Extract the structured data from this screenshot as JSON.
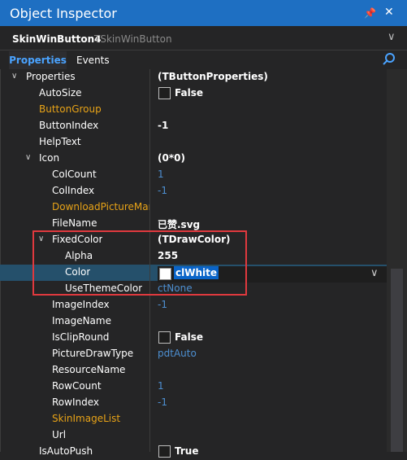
{
  "window": {
    "title": "Object Inspector",
    "pin_icon": "pin-icon",
    "close_icon": "close-icon"
  },
  "object_selector": {
    "name": "SkinWinButton4",
    "type": "TSkinWinButton"
  },
  "tabs": [
    {
      "label": "Properties",
      "active": true
    },
    {
      "label": "Events",
      "active": false
    }
  ],
  "colors": {
    "accent": "#1e6fc2",
    "selected_row": "#25506b",
    "highlight_box": "#e0393e",
    "orange_name": "#e8a317",
    "blue_value": "#4d8fd1"
  },
  "rows": [
    {
      "name": "Properties",
      "value": "(TButtonProperties)"
    },
    {
      "name": "AutoSize",
      "value": "False"
    },
    {
      "name": "ButtonGroup",
      "value": ""
    },
    {
      "name": "ButtonIndex",
      "value": "-1"
    },
    {
      "name": "HelpText",
      "value": ""
    },
    {
      "name": "Icon",
      "value": "(0*0)"
    },
    {
      "name": "ColCount",
      "value": "1"
    },
    {
      "name": "ColIndex",
      "value": "-1"
    },
    {
      "name": "DownloadPictureMana",
      "value": ""
    },
    {
      "name": "FileName",
      "value": "已赞.svg"
    },
    {
      "name": "FixedColor",
      "value": "(TDrawColor)"
    },
    {
      "name": "Alpha",
      "value": "255"
    },
    {
      "name": "Color",
      "value": "clWhite"
    },
    {
      "name": "UseThemeColor",
      "value": "ctNone"
    },
    {
      "name": "ImageIndex",
      "value": "-1"
    },
    {
      "name": "ImageName",
      "value": ""
    },
    {
      "name": "IsClipRound",
      "value": "False"
    },
    {
      "name": "PictureDrawType",
      "value": "pdtAuto"
    },
    {
      "name": "ResourceName",
      "value": ""
    },
    {
      "name": "RowCount",
      "value": "1"
    },
    {
      "name": "RowIndex",
      "value": "-1"
    },
    {
      "name": "SkinImageList",
      "value": ""
    },
    {
      "name": "Url",
      "value": ""
    },
    {
      "name": "IsAutoPush",
      "value": "True"
    }
  ]
}
